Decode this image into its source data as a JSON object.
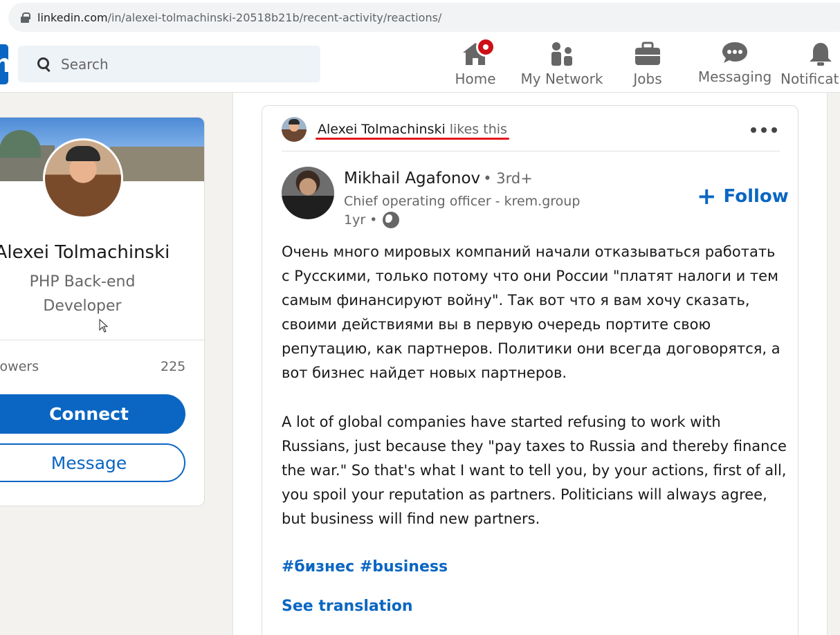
{
  "browser": {
    "url_host": "linkedin.com",
    "url_path": "/in/alexei-tolmachinski-20518b21b/recent-activity/reactions/"
  },
  "nav": {
    "logo_text": "in",
    "search_placeholder": "Search",
    "items": [
      {
        "label": "Home",
        "icon": "home-icon"
      },
      {
        "label": "My Network",
        "icon": "network-icon"
      },
      {
        "label": "Jobs",
        "icon": "briefcase-icon"
      },
      {
        "label": "Messaging",
        "icon": "messaging-icon"
      },
      {
        "label": "Notificatio",
        "icon": "bell-icon"
      }
    ],
    "accent": "#0a66c2",
    "badge_color": "#cc1016"
  },
  "profile": {
    "name": "Alexei Tolmachinski",
    "title": "PHP Back-end Developer",
    "followers_label": "llowers",
    "followers_count": "225",
    "connect_label": "Connect",
    "message_label": "Message"
  },
  "activity": {
    "actor": "Alexei Tolmachinski",
    "action": "likes this"
  },
  "post": {
    "author": "Mikhail Agafonov",
    "degree": "• 3rd+",
    "headline": "Chief operating officer - krem.group",
    "time": "1yr •",
    "follow_label": "Follow",
    "text_ru": "Очень много мировых компаний начали отказываться работать с Русскими, только потому что они России \"платят налоги и тем самым финансируют войну\". Так вот что я вам хочу сказать, своими действиями вы в первую очередь портите свою репутацию, как партнеров. Политики они всегда договорятся, а вот бизнес найдет новых партнеров.",
    "text_en": "A lot of global companies have started refusing to work with Russians, just because they \"pay taxes to Russia and thereby finance the war.\" So that's what I want to tell you, by your actions, first of all, you spoil your reputation as partners. Politicians will always agree, but business will find new partners.",
    "hashtags": "#бизнес #business",
    "see_translation": "See translation"
  }
}
